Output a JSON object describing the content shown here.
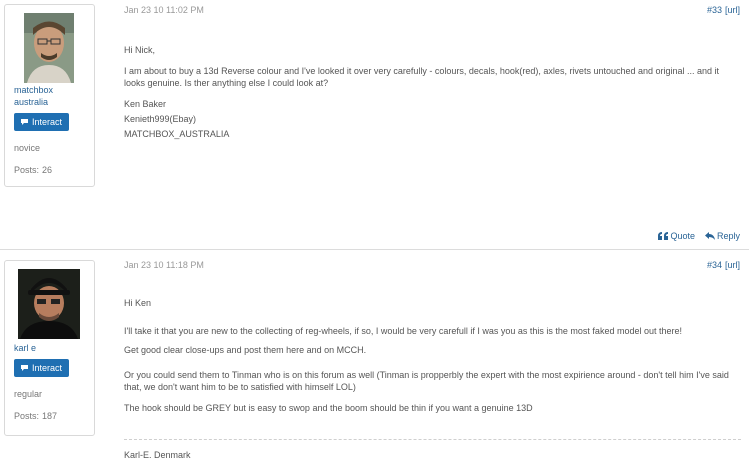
{
  "posts": [
    {
      "user": {
        "name_line1": "matchbox",
        "name_line2": "australia",
        "rank": "novice",
        "posts_label": "Posts:",
        "posts_count": "26"
      },
      "interact_label": "Interact",
      "date": "Jan 23 10 11:02 PM",
      "number": "#33",
      "url_label": "[url]",
      "paragraphs": [
        "Hi Nick,",
        "I am about to buy a 13d Reverse colour and I've looked it over very carefully - colours, decals, hook(red), axles, rivets untouched and original ... and it looks genuine. Is ther anything else I could look at?",
        "Ken Baker",
        "Kenieth999(Ebay)",
        "MATCHBOX_AUSTRALIA"
      ],
      "actions": {
        "quote": "Quote",
        "reply": "Reply"
      }
    },
    {
      "user": {
        "name_line1": "karl e",
        "rank": "regular",
        "posts_label": "Posts:",
        "posts_count": "187"
      },
      "interact_label": "Interact",
      "date": "Jan 23 10 11:18 PM",
      "number": "#34",
      "url_label": "[url]",
      "paragraphs": [
        "Hi Ken",
        "I'll take it that you are new to the collecting of reg-wheels, if so, I would be very carefull if I was you as this is the most faked model out there!",
        "Get good clear close-ups and post them here and on MCCH.",
        "Or you could send them to Tinman who is on this forum as well (Tinman is propperbly the expert with the most expirience around - don't tell him I've said that, we don't want him to be to satisfied with himself LOL)",
        "The hook should be GREY but is easy to swop and the boom should be thin if you want a genuine 13D"
      ],
      "signature": "Karl-E. Denmark"
    }
  ],
  "colors": {
    "accent": "#1f6fb2",
    "link": "#2a6496",
    "border": "#d9d9d9"
  },
  "icons": [
    "chat-bubble-icon",
    "quote-icon",
    "reply-arrow-icon"
  ]
}
